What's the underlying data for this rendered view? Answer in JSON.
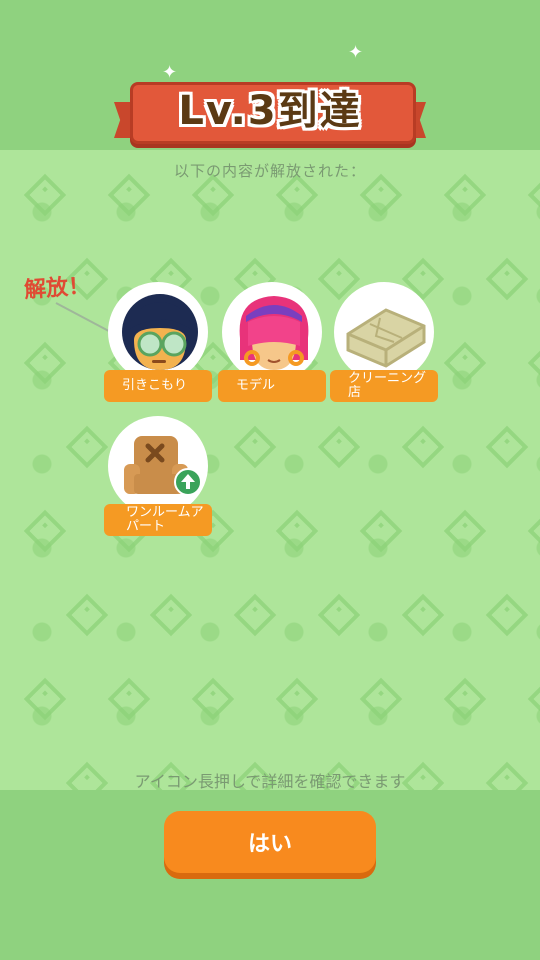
{
  "header": {
    "title": "Lv.3到達",
    "subtitle": "以下の内容が解放された："
  },
  "unlock_badge": "解放！",
  "items": [
    {
      "label": "引きこもり",
      "icon": "hikikomori-character-icon",
      "new": true
    },
    {
      "label": "モデル",
      "icon": "model-character-icon"
    },
    {
      "label": "クリーニング店",
      "icon": "cleaning-shop-icon"
    },
    {
      "label": "ワンルームアパート",
      "icon": "one-room-apartment-icon",
      "upgrade": true
    }
  ],
  "hint": "アイコン長押しで詳細を確認できます",
  "confirm_button": "はい",
  "colors": {
    "background": "#8fd27f",
    "panel": "#aee59a",
    "ribbon": "#e2583a",
    "label": "#f59a23",
    "button": "#f88a1e"
  }
}
